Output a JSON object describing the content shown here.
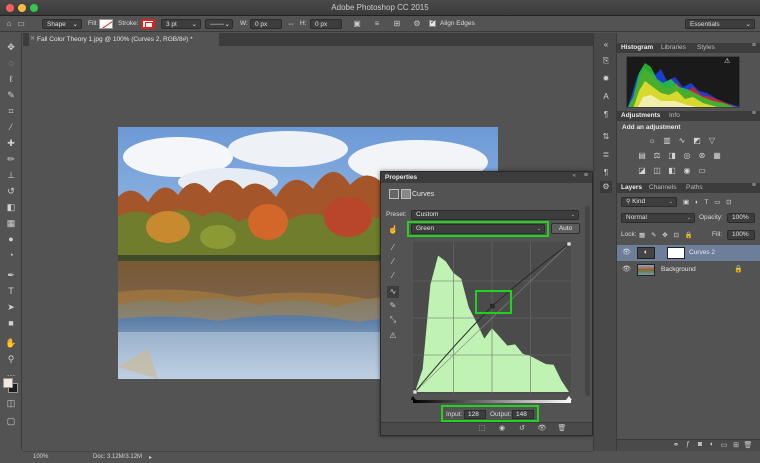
{
  "window": {
    "title": "Adobe Photoshop CC 2015"
  },
  "options_bar": {
    "tool_mode": "Shape",
    "fill_label": "Fill:",
    "stroke_label": "Stroke:",
    "stroke_width": "3 pt",
    "w_label": "W:",
    "w_value": "0 px",
    "h_label": "H:",
    "h_value": "0 px",
    "align_edges_label": "Align Edges",
    "workspace": "Essentials"
  },
  "document": {
    "tab_title": "Fall Color Theory 1.jpg @ 100% (Curves 2, RGB/8#) *",
    "zoom": "100%",
    "doc_size": "Doc: 3.12M/3.12M"
  },
  "properties": {
    "header": "Properties",
    "adjustment_name": "Curves",
    "preset_label": "Preset:",
    "preset_value": "Custom",
    "channel_value": "Green",
    "auto_label": "Auto",
    "input_label": "Input:",
    "input_value": "128",
    "output_label": "Output:",
    "output_value": "148"
  },
  "chart_data": {
    "type": "area",
    "title": "",
    "xlabel": "",
    "ylabel": "",
    "xlim": [
      0,
      255
    ],
    "ylim": [
      0,
      255
    ],
    "curve_points": [
      [
        0,
        0
      ],
      [
        128,
        148
      ],
      [
        255,
        255
      ]
    ],
    "histogram": [
      0,
      40,
      185,
      235,
      225,
      205,
      195,
      145,
      120,
      92,
      110,
      95,
      80,
      82,
      66,
      62,
      55,
      48,
      47,
      20,
      0
    ]
  },
  "histogram_panel": {
    "tabs": [
      "Histogram",
      "Libraries",
      "Styles"
    ]
  },
  "adjustments_panel": {
    "tabs": [
      "Adjustments",
      "Info"
    ],
    "hint": "Add an adjustment"
  },
  "layers_panel": {
    "tabs": [
      "Layers",
      "Channels",
      "Paths"
    ],
    "filter": "Kind",
    "blend_mode": "Normal",
    "opacity_label": "Opacity:",
    "opacity_value": "100%",
    "lock_label": "Lock:",
    "fill_label": "Fill:",
    "fill_value": "100%",
    "layers": [
      {
        "name": "Curves 2"
      },
      {
        "name": "Background"
      }
    ]
  },
  "colors": {
    "highlight": "#21d321",
    "histogram_fill": "#bff2b3",
    "selected_layer": "#6d7e9a"
  }
}
